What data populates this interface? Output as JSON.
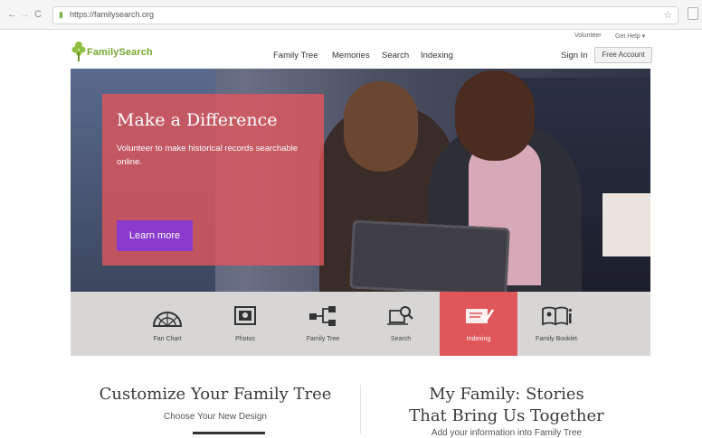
{
  "browser": {
    "back": "←",
    "forward": "→",
    "reload": "C",
    "url": "https://familysearch.org",
    "bookmark": "☆"
  },
  "header": {
    "utility": [
      "Volunteer",
      "Get Help ▾"
    ],
    "logo_text": "FamilySearch",
    "nav": [
      "Family Tree",
      "Memories",
      "Search",
      "Indexing"
    ],
    "sign_in": "Sign In",
    "free_account": "Free Account"
  },
  "hero": {
    "title": "Make a Difference",
    "body": "Volunteer to make historical records searchable online.",
    "button": "Learn more"
  },
  "features": [
    {
      "label": "Fan Chart",
      "icon": "fan-chart-icon",
      "active": false
    },
    {
      "label": "Photos",
      "icon": "photos-icon",
      "active": false
    },
    {
      "label": "Family Tree",
      "icon": "family-tree-icon",
      "active": false
    },
    {
      "label": "Search",
      "icon": "search-icon",
      "active": false
    },
    {
      "label": "Indexing",
      "icon": "indexing-icon",
      "active": true
    },
    {
      "label": "Family Booklet",
      "icon": "family-booklet-icon",
      "active": false
    }
  ],
  "sections": {
    "left_title": "Customize Your Family Tree",
    "left_sub": "Choose Your New Design",
    "right_title_1": "My Family: Stories",
    "right_title_2": "That Bring Us Together",
    "right_sub": "Add your information into Family Tree"
  },
  "colors": {
    "accent": "#e0575b",
    "button": "#8a3bcd",
    "brand_green": "#7aa82f"
  }
}
